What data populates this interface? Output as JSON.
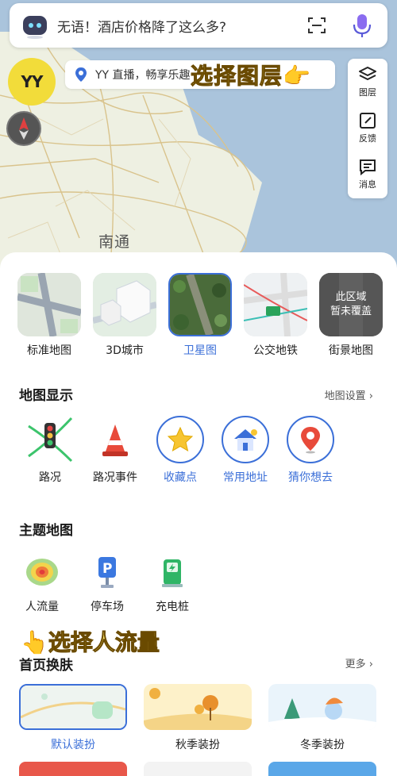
{
  "search": {
    "text": "无语！酒店价格降了这么多?"
  },
  "logo": {
    "text": "YY"
  },
  "banner": {
    "text": "YY 直播，畅享乐趣"
  },
  "annotations": {
    "layer": "选择图层👉",
    "flow": "👆选择人流量"
  },
  "map": {
    "city_label": "南通"
  },
  "tools": [
    {
      "label": "图层",
      "icon": "layers-icon"
    },
    {
      "label": "反馈",
      "icon": "edit-icon"
    },
    {
      "label": "消息",
      "icon": "message-icon"
    }
  ],
  "layers": [
    {
      "label": "标准地图",
      "selected": false
    },
    {
      "label": "3D城市",
      "selected": false
    },
    {
      "label": "卫星图",
      "selected": true
    },
    {
      "label": "公交地铁",
      "selected": false
    },
    {
      "label": "街景地图",
      "selected": false,
      "overlay": "此区域\n暂未覆盖"
    }
  ],
  "map_display": {
    "title": "地图显示",
    "link": "地图设置 ›",
    "items": [
      {
        "label": "路况",
        "selected": false
      },
      {
        "label": "路况事件",
        "selected": false
      },
      {
        "label": "收藏点",
        "selected": true
      },
      {
        "label": "常用地址",
        "selected": true
      },
      {
        "label": "猜你想去",
        "selected": true
      }
    ]
  },
  "theme_map": {
    "title": "主题地图",
    "items": [
      {
        "label": "人流量"
      },
      {
        "label": "停车场"
      },
      {
        "label": "充电桩"
      }
    ]
  },
  "skins": {
    "title": "首页换肤",
    "link": "更多 ›",
    "items": [
      {
        "label": "默认装扮",
        "selected": true
      },
      {
        "label": "秋季装扮",
        "selected": false
      },
      {
        "label": "冬季装扮",
        "selected": false
      }
    ]
  },
  "colors": {
    "accent": "#3b6fd8",
    "land": "#eef0e2",
    "water": "#aac4dc"
  }
}
